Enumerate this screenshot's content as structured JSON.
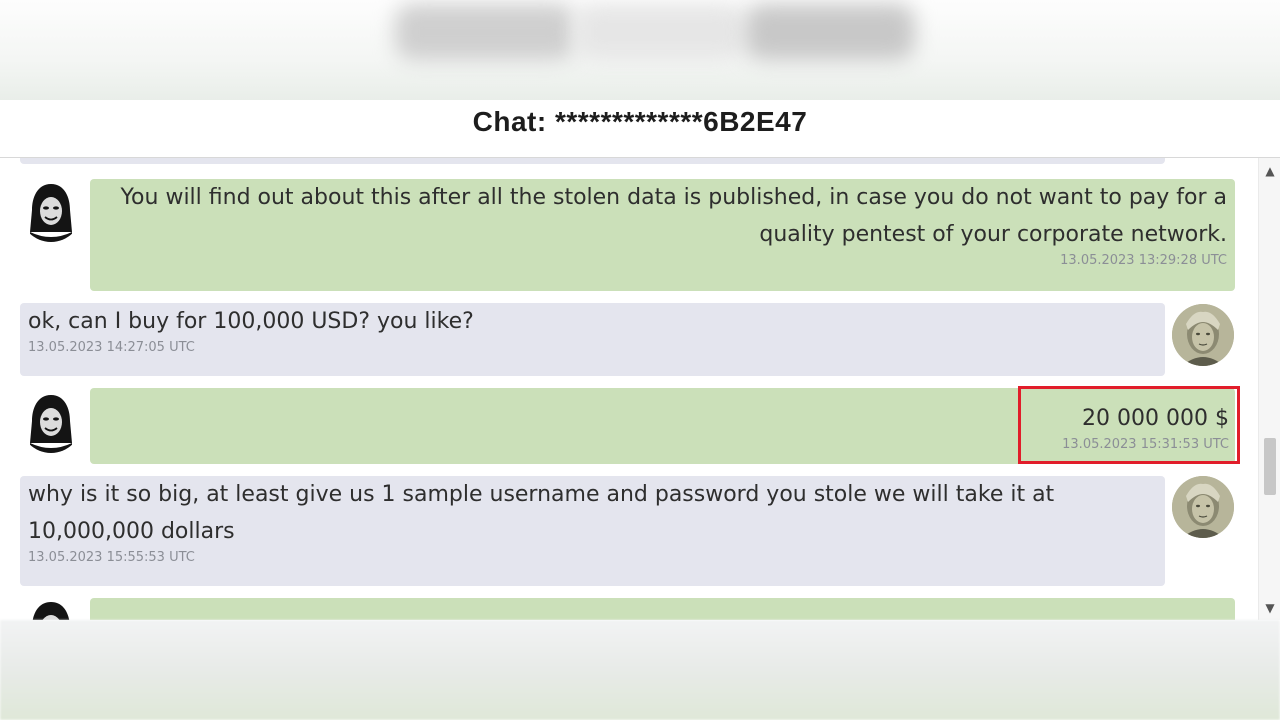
{
  "header": {
    "title": "Chat: *************6B2E47"
  },
  "messages": [
    {
      "side": "theirs",
      "text": "You will find out about this after all the stolen data is published, in case you do not want to pay for a quality pentest of your corporate network.",
      "time": "13.05.2023 13:29:28 UTC"
    },
    {
      "side": "mine",
      "text": "ok, can I buy for 100,000 USD? you like?",
      "time": "13.05.2023 14:27:05 UTC"
    },
    {
      "side": "theirs",
      "text": "20 000 000 $",
      "time": "13.05.2023 15:31:53 UTC",
      "highlighted": true
    },
    {
      "side": "mine",
      "text": "why is it so big, at least give us 1 sample username and password you stole we will take it at 10,000,000 dollars",
      "time": "13.05.2023 15:55:53 UTC"
    }
  ],
  "avatars": {
    "theirs": "hooded-hacker-icon",
    "mine": "franklin-banknote-icon"
  },
  "colors": {
    "theirs_bubble": "#cbe0b9",
    "mine_bubble": "#e4e5ee",
    "highlight": "#e11d2a",
    "timestamp": "#8b8e96"
  }
}
